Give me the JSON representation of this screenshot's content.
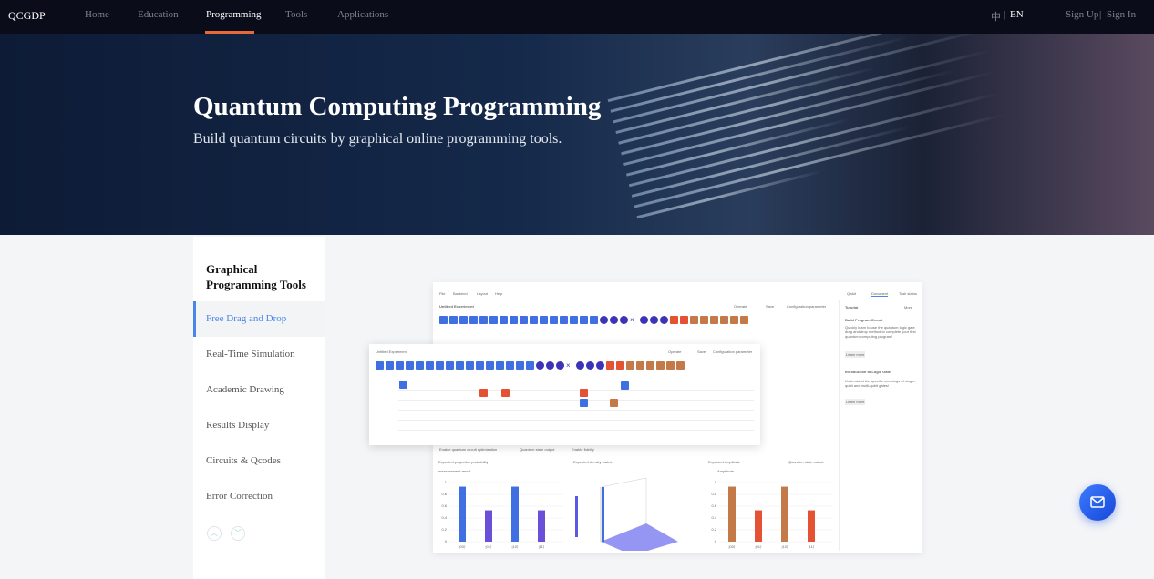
{
  "nav": {
    "logo": "QCGDP",
    "items": [
      "Home",
      "Education",
      "Programming",
      "Tools",
      "Applications"
    ],
    "active": "Programming",
    "lang_zh": "中",
    "lang_sep": "|",
    "lang_en": "EN",
    "sign_up": "Sign Up",
    "auth_sep": "|",
    "sign_in": "Sign In"
  },
  "hero": {
    "title": "Quantum Computing Programming",
    "subtitle": "Build quantum circuits by graphical online programming tools."
  },
  "sidebar": {
    "title": "Graphical Programming Tools",
    "items": [
      "Free Drag and Drop",
      "Real-Time Simulation",
      "Academic Drawing",
      "Results Display",
      "Circuits & Qcodes",
      "Error Correction"
    ],
    "selected": "Free Drag and Drop"
  },
  "preview": {
    "menu": [
      "File",
      "Backend",
      "Layout",
      "Help"
    ],
    "right_tabs": [
      "Qiskit",
      "Document",
      "Task status"
    ],
    "experiment": "Untitled Experiment",
    "operate": "Operate",
    "save": "Save",
    "config": "Configuration parameter",
    "tutorial": "Tutorial",
    "more": "More",
    "t1_title": "Build Program Circuit",
    "t1_desc": "Quickly learn to use the quantum logic gate drag and drop method to complete your first quantum computing program!",
    "learn_more": "Learn more",
    "t2_title": "Introduction to Logic Gate",
    "t2_desc": "Understand the specific meanings of single-qubit and multi-qubit gates!",
    "options": [
      "Enable quantum circuit optimization",
      "Quantum state output",
      "Enable fidelity"
    ],
    "charts": [
      {
        "title": "Expected projection probability",
        "ylabel": "measurement result",
        "categories": [
          "|00⟩",
          "|01⟩",
          "|10⟩",
          "|11⟩"
        ],
        "values": [
          0.93,
          0.53,
          0.93,
          0.53
        ],
        "colors": [
          "#3f6fe0",
          "#6a4fd8",
          "#3f6fe0",
          "#6a4fd8"
        ]
      },
      {
        "title": "Expected density matrix"
      },
      {
        "title": "Expected amplitude",
        "extra": "Quantum state output",
        "ylabel": "Amplitude",
        "categories": [
          "|00⟩",
          "|01⟩",
          "|10⟩",
          "|11⟩"
        ],
        "values": [
          0.93,
          0.53,
          0.93,
          0.53
        ],
        "colors": [
          "#c47a48",
          "#e55233",
          "#c47a48",
          "#e55233"
        ]
      }
    ],
    "float_title": "Untitled Experiment"
  },
  "colors": {
    "accent": "#4a86e8",
    "nav_underline": "#e8683a",
    "nav_bg": "#0a0d19"
  },
  "icons": {
    "mail": "mail-icon",
    "up": "chevron-up-icon",
    "down": "chevron-down-icon"
  }
}
